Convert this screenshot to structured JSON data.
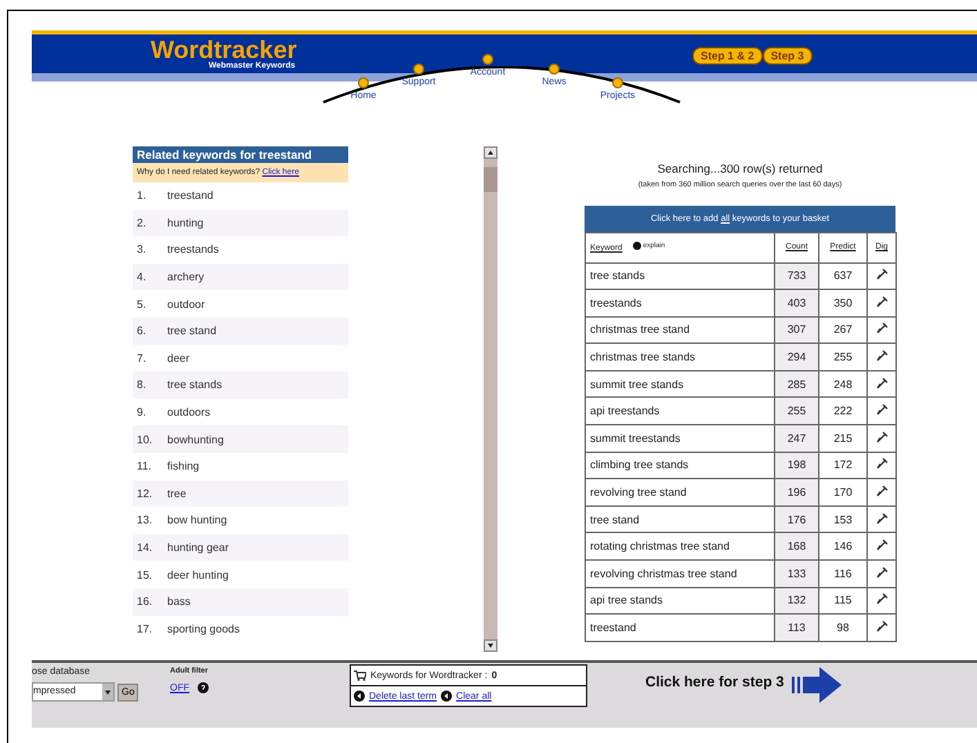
{
  "header": {
    "logo": "Wordtracker",
    "tagline": "Webmaster Keywords",
    "nav": [
      {
        "label": "Home"
      },
      {
        "label": "Support"
      },
      {
        "label": "Account"
      },
      {
        "label": "News"
      },
      {
        "label": "Projects"
      }
    ],
    "steps": [
      {
        "label": "Step 1 & 2"
      },
      {
        "label": "Step 3"
      }
    ]
  },
  "related": {
    "title": "Related keywords for treestand",
    "hint": "Why do I need related keywords?",
    "hint_link": "Click here",
    "items": [
      {
        "number": "1.",
        "keyword": "treestand"
      },
      {
        "number": "2.",
        "keyword": "hunting"
      },
      {
        "number": "3.",
        "keyword": "treestands"
      },
      {
        "number": "4.",
        "keyword": "archery"
      },
      {
        "number": "5.",
        "keyword": "outdoor"
      },
      {
        "number": "6.",
        "keyword": "tree stand"
      },
      {
        "number": "7.",
        "keyword": "deer"
      },
      {
        "number": "8.",
        "keyword": "tree stands"
      },
      {
        "number": "9.",
        "keyword": "outdoors"
      },
      {
        "number": "10.",
        "keyword": "bowhunting"
      },
      {
        "number": "11.",
        "keyword": "fishing"
      },
      {
        "number": "12.",
        "keyword": "tree"
      },
      {
        "number": "13.",
        "keyword": "bow hunting"
      },
      {
        "number": "14.",
        "keyword": "hunting gear"
      },
      {
        "number": "15.",
        "keyword": "deer hunting"
      },
      {
        "number": "16.",
        "keyword": "bass"
      },
      {
        "number": "17.",
        "keyword": "sporting goods"
      }
    ]
  },
  "results": {
    "status": "Searching...300 row(s) returned",
    "note": "(taken from 360 million search queries over the last 60 days)",
    "add_all": {
      "before": "Click here to add",
      "link": "all",
      "after": "keywords to your basket"
    },
    "explain": "explain",
    "columns": [
      {
        "label": "Keyword"
      },
      {
        "label": "Count"
      },
      {
        "label": "Predict"
      },
      {
        "label": "Dig"
      }
    ],
    "rows": [
      {
        "keyword": "tree stands",
        "count": "733",
        "predict": "637"
      },
      {
        "keyword": "treestands",
        "count": "403",
        "predict": "350"
      },
      {
        "keyword": "christmas tree stand",
        "count": "307",
        "predict": "267"
      },
      {
        "keyword": "christmas tree stands",
        "count": "294",
        "predict": "255"
      },
      {
        "keyword": "summit tree stands",
        "count": "285",
        "predict": "248"
      },
      {
        "keyword": "api treestands",
        "count": "255",
        "predict": "222"
      },
      {
        "keyword": "summit treestands",
        "count": "247",
        "predict": "215"
      },
      {
        "keyword": "climbing tree stands",
        "count": "198",
        "predict": "172"
      },
      {
        "keyword": "revolving tree stand",
        "count": "196",
        "predict": "170"
      },
      {
        "keyword": "tree stand",
        "count": "176",
        "predict": "153"
      },
      {
        "keyword": "rotating christmas tree stand",
        "count": "168",
        "predict": "146"
      },
      {
        "keyword": "revolving christmas tree stand",
        "count": "133",
        "predict": "116"
      },
      {
        "keyword": "api tree stands",
        "count": "132",
        "predict": "115"
      },
      {
        "keyword": "treestand",
        "count": "113",
        "predict": "98"
      }
    ]
  },
  "footer": {
    "database": {
      "label": "ose database",
      "value": "mpressed",
      "go": "Go"
    },
    "adult_filter": {
      "label": "Adult filter",
      "value": "OFF"
    },
    "basket": {
      "label": "Keywords for Wordtracker :",
      "count": "0",
      "delete": "Delete last term",
      "clear": "Clear all"
    },
    "step3": "Click here for step 3"
  }
}
